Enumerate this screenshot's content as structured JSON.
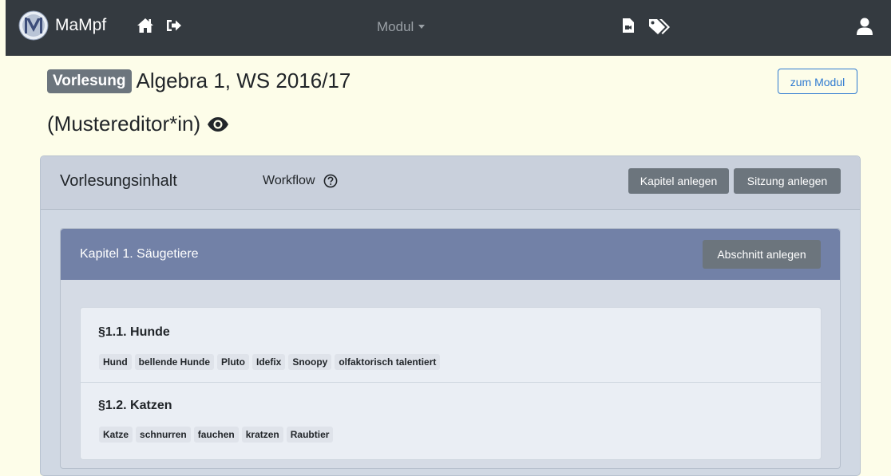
{
  "navbar": {
    "brand": "MaMpf",
    "modul_dropdown": "Modul"
  },
  "header": {
    "badge": "Vorlesung",
    "title": "Algebra 1, WS 2016/17",
    "subtitle": "(Mustereditor*in)",
    "to_module_button": "zum Modul"
  },
  "content_card": {
    "title": "Vorlesungsinhalt",
    "workflow_label": "Workflow",
    "create_chapter_button": "Kapitel anlegen",
    "create_session_button": "Sitzung anlegen"
  },
  "chapter": {
    "title": "Kapitel 1. Säugetiere",
    "create_section_button": "Abschnitt anlegen",
    "sections": [
      {
        "title": "§1.1. Hunde",
        "tags": [
          "Hund",
          "bellende Hunde",
          "Pluto",
          "Idefix",
          "Snoopy",
          "olfaktorisch talentiert"
        ]
      },
      {
        "title": "§1.2. Katzen",
        "tags": [
          "Katze",
          "schnurren",
          "fauchen",
          "kratzen",
          "Raubtier"
        ]
      }
    ]
  }
}
